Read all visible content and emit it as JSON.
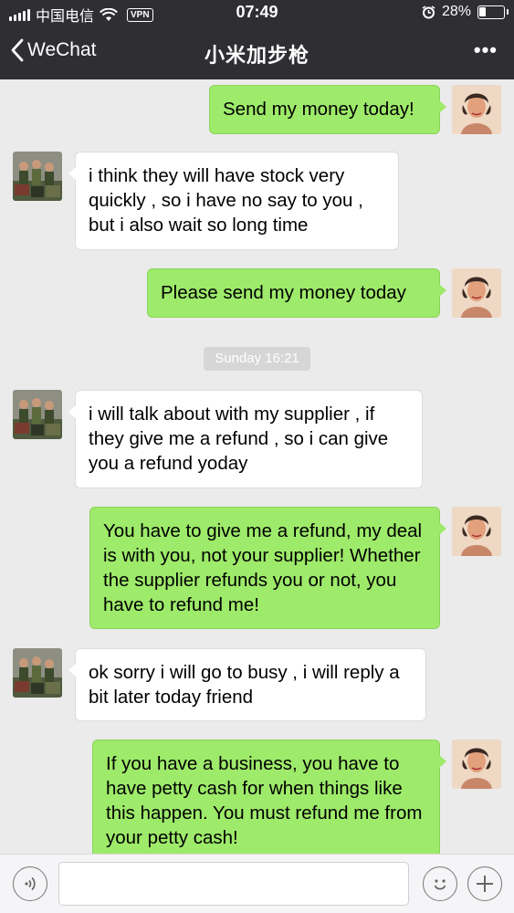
{
  "status_bar": {
    "carrier": "中国电信",
    "vpn": "VPN",
    "time": "07:49",
    "battery": "28%",
    "battery_level": 0.28
  },
  "nav": {
    "back_label": "WeChat",
    "title": "小米加步枪",
    "more": "•••"
  },
  "messages": [
    {
      "side": "sent",
      "text": "Send my money today!"
    },
    {
      "side": "recv",
      "text": "i think they will have stock very quickly , so i have no say to you , but i also wait so long time"
    },
    {
      "side": "sent",
      "text": "Please send my money today"
    },
    {
      "side": "recv",
      "text": "i will talk about with my supplier , if they give me a refund , so i can give you a refund yoday"
    },
    {
      "side": "sent",
      "text": "You have to give me a refund, my deal is with you, not your supplier! Whether the supplier refunds you or not, you have to refund me!"
    },
    {
      "side": "recv",
      "text": "ok sorry i will go to busy , i will reply a bit later today friend"
    },
    {
      "side": "sent",
      "text": "If you have a business, you have to have petty cash for when things like this happen. You must refund me from your petty cash!"
    }
  ],
  "timestamp": "Sunday 16:21",
  "colors": {
    "header_bg": "#2e2e33",
    "chat_bg": "#ebebeb",
    "sent_bubble": "#9eea6a",
    "recv_bubble": "#ffffff"
  },
  "input_bar": {
    "voice_icon": "voice-icon",
    "emoji_icon": "emoji-icon",
    "plus_icon": "plus-icon",
    "placeholder": ""
  }
}
